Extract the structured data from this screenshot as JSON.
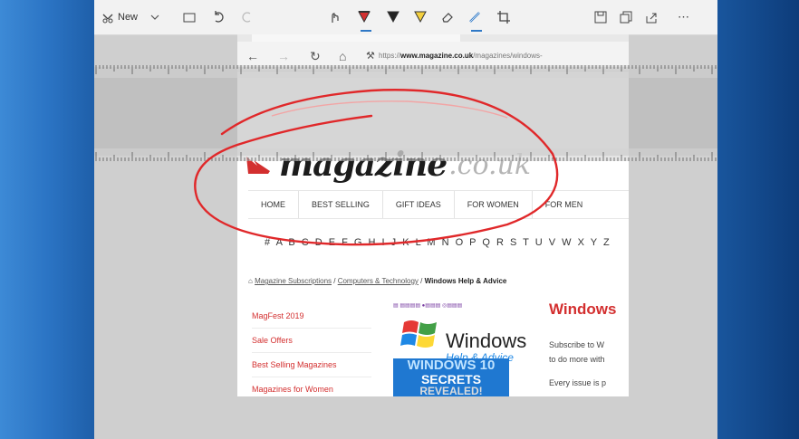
{
  "toolbar": {
    "new_label": "New",
    "more_label": "⋯"
  },
  "browser": {
    "url_prefix": "https://",
    "url_domain": "www.magazine.co.uk",
    "url_path": "/magazines/windows-"
  },
  "site": {
    "logo_word": "magazine",
    "logo_suffix": ".co.uk",
    "nav": [
      "HOME",
      "BEST SELLING",
      "GIFT IDEAS",
      "FOR WOMEN",
      "FOR MEN"
    ],
    "alphabet": "# A B C D E F G H I J K L M N O P Q R S T U V W X Y Z",
    "breadcrumb": {
      "home_icon": "home-icon",
      "link1": "Magazine Subscriptions",
      "sep": " / ",
      "link2": "Computers & Technology",
      "current": "Windows Help & Advice"
    },
    "sidelinks": [
      "MagFest 2019",
      "Sale Offers",
      "Best Selling Magazines",
      "Magazines for Women"
    ],
    "cover": {
      "logos": "▤ ▤▤▤▤  ●▤▤▤  ◎▤▤▤",
      "brand_word": "Windows",
      "brand_sub": "Help & Advice",
      "banner1": "WINDOWS 10",
      "banner2": "SECRETS",
      "banner3": "REVEALED!"
    },
    "heading": "Windows",
    "text1": "Subscribe to W",
    "text2": "to do more with",
    "text3": "Every issue is p"
  },
  "colors": {
    "accent": "#2f78c6",
    "red": "#d32f2f",
    "desktop": "#1b5aa3"
  }
}
